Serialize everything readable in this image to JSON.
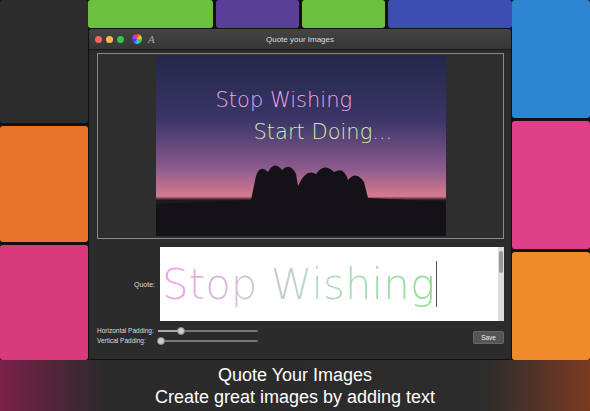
{
  "window": {
    "title": "Quote your Images"
  },
  "toolbar": {
    "font_button": "A"
  },
  "preview": {
    "lines": [
      "Stop Wishing",
      "Start Doing..."
    ]
  },
  "quote": {
    "label": "Quote:",
    "value": "Stop Wishing"
  },
  "sliders": [
    {
      "label": "Horizontal Padding:",
      "level": 0.23
    },
    {
      "label": "Vertical Padding:",
      "level": 0.03
    }
  ],
  "buttons": [
    "Save"
  ],
  "caption": {
    "title": "Quote Your Images",
    "subtitle": "Create great images by adding text"
  }
}
